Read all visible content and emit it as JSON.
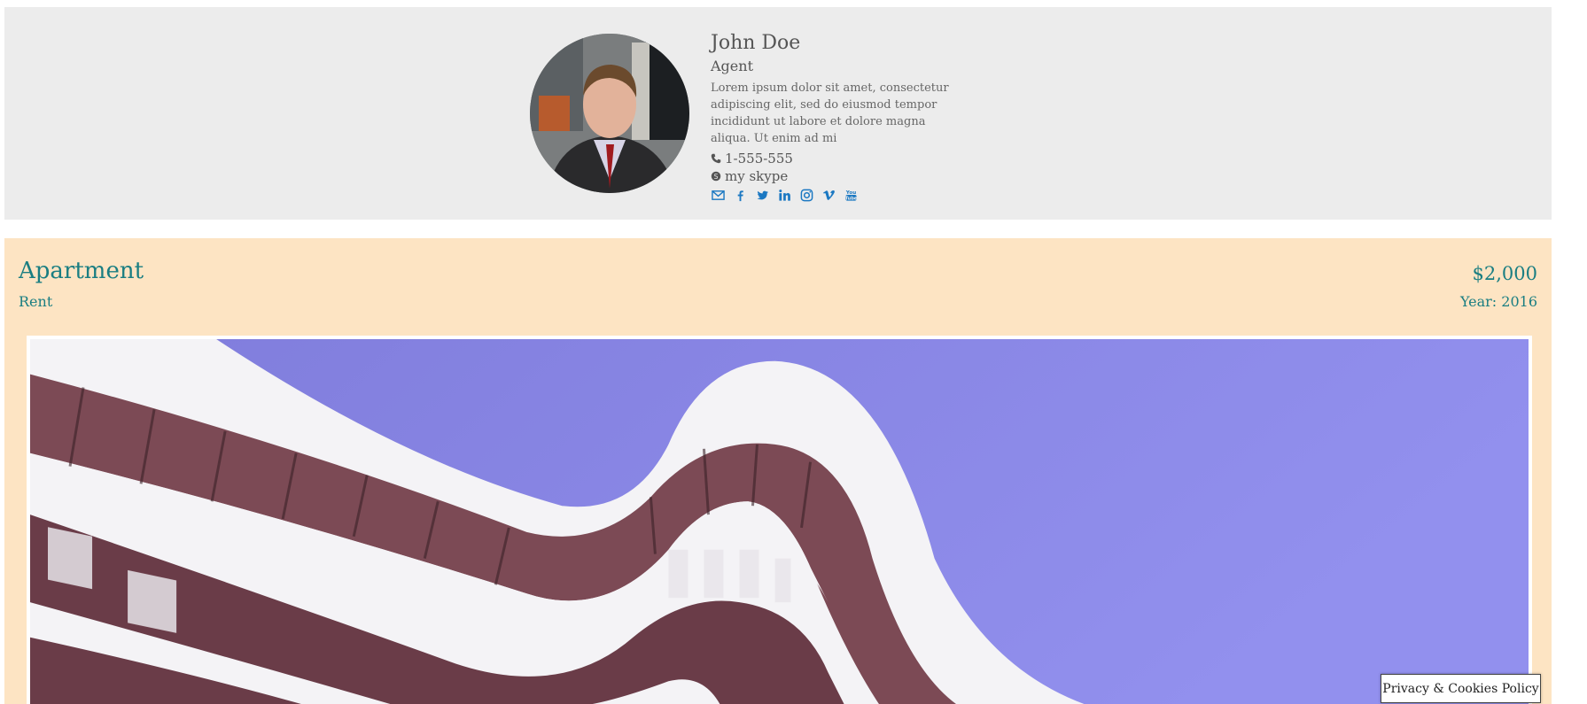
{
  "agent": {
    "name": "John Doe",
    "role": "Agent",
    "description": "Lorem ipsum dolor sit amet, consectetur adipiscing elit, sed do eiusmod tempor incididunt ut labore et dolore magna aliqua. Ut enim ad mi",
    "phone": "1-555-555",
    "skype": "my skype",
    "social_icons": [
      "envelope-icon",
      "facebook-icon",
      "twitter-icon",
      "linkedin-icon",
      "instagram-icon",
      "vimeo-icon",
      "youtube-icon"
    ]
  },
  "property": {
    "title": "Apartment",
    "type": "Rent",
    "price": "$2,000",
    "year": "Year: 2016"
  },
  "footer": {
    "policy_label": "Privacy & Cookies Policy"
  },
  "colors": {
    "agent_bg": "#ececec",
    "property_bg": "#fde4c3",
    "accent": "#1a7e82",
    "link": "#1b78c2",
    "sky": "#8a88e6"
  }
}
